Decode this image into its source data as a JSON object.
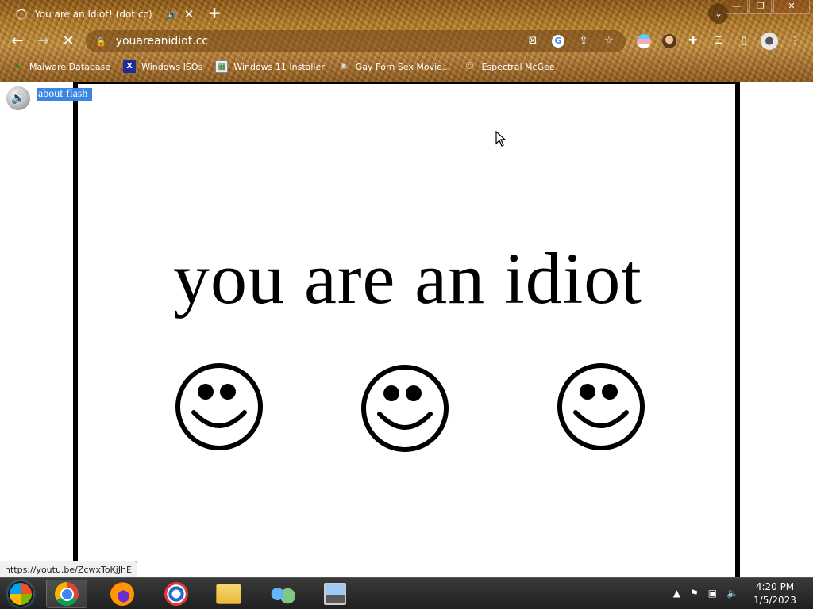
{
  "browser": {
    "tab": {
      "title": "You are an Idiot! (dot cc)",
      "sound_icon": "speaker-icon",
      "close_glyph": "✕"
    },
    "new_tab_glyph": "+",
    "tab_search_glyph": "⌄",
    "window_buttons": {
      "minimize": "—",
      "restore": "❐",
      "close": "✕"
    },
    "nav": {
      "back": "←",
      "forward": "→",
      "stop": "✕"
    },
    "address": {
      "url": "youareanidiot.cc",
      "lock": "🔒"
    },
    "omnibox_icons": {
      "popup_blocked": "⊠",
      "google": "G",
      "share": "⇪",
      "bookmark": "☆"
    },
    "toolbar_icons": {
      "extensions": "✚",
      "reading_list": "☰",
      "side_panel": "▯",
      "profile": "●",
      "menu": "⋮"
    },
    "bookmarks": [
      {
        "label": "Malware Database",
        "icon": "leaf-icon",
        "glyph": "❦"
      },
      {
        "label": "Windows ISOs",
        "icon": "x-icon",
        "glyph": "X"
      },
      {
        "label": "Windows 11 Installer",
        "icon": "picture-icon",
        "glyph": "▦"
      },
      {
        "label": "Gay Porn Sex Movie...",
        "icon": "disk-icon",
        "glyph": "◉"
      },
      {
        "label": "Espectral McGee",
        "icon": "face-icon",
        "glyph": "☺"
      }
    ],
    "status_url": "https://youtu.be/ZcwxToKjJhE"
  },
  "page": {
    "speaker_glyph": "🔊",
    "flash_links": [
      "about",
      "flash"
    ],
    "headline": "you are an idiot",
    "smiley_count": 3
  },
  "taskbar": {
    "tray": {
      "show_hidden": "▲",
      "flag": "⚑",
      "network": "▣",
      "volume": "🔈"
    },
    "clock": {
      "time": "4:20 PM",
      "date": "1/5/2023"
    }
  }
}
